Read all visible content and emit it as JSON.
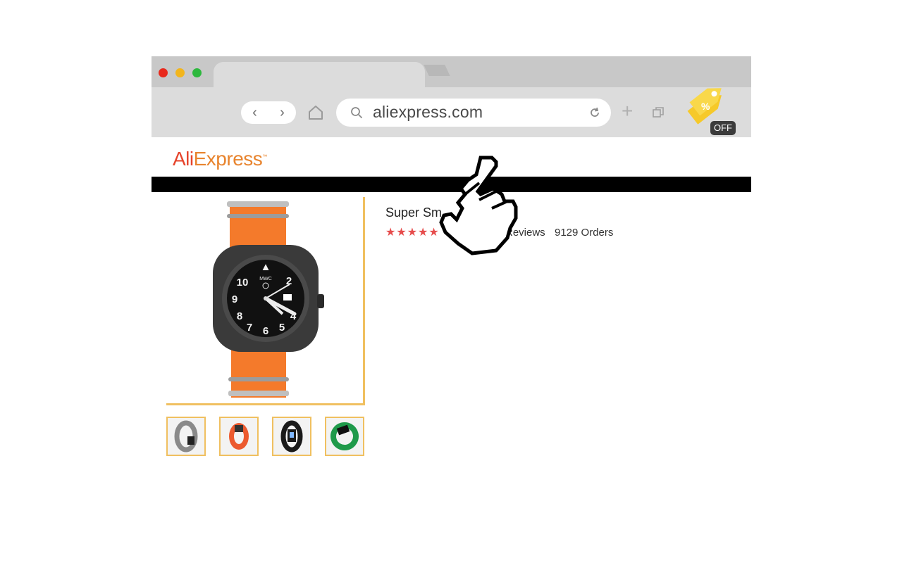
{
  "browser": {
    "url": "aliexpress.com",
    "extension_badge": "OFF"
  },
  "page": {
    "logo_ali": "Ali",
    "logo_express": "Express",
    "product_title": "Super Sm",
    "stars": "★★★★★",
    "reviews_label": "Reviews",
    "orders_label": "9129 Orders",
    "rating": 5
  },
  "colors": {
    "accent_gold": "#f0c060",
    "star_red": "#e64c4c",
    "coupon_yellow": "#f6c929",
    "logo_red": "#e6442c",
    "logo_orange": "#e8842e"
  },
  "icons": [
    "back-icon",
    "forward-icon",
    "home-icon",
    "search-icon",
    "reload-icon",
    "new-tab-icon",
    "tabs-icon",
    "coupon-tag-icon",
    "pointer-hand-icon"
  ]
}
